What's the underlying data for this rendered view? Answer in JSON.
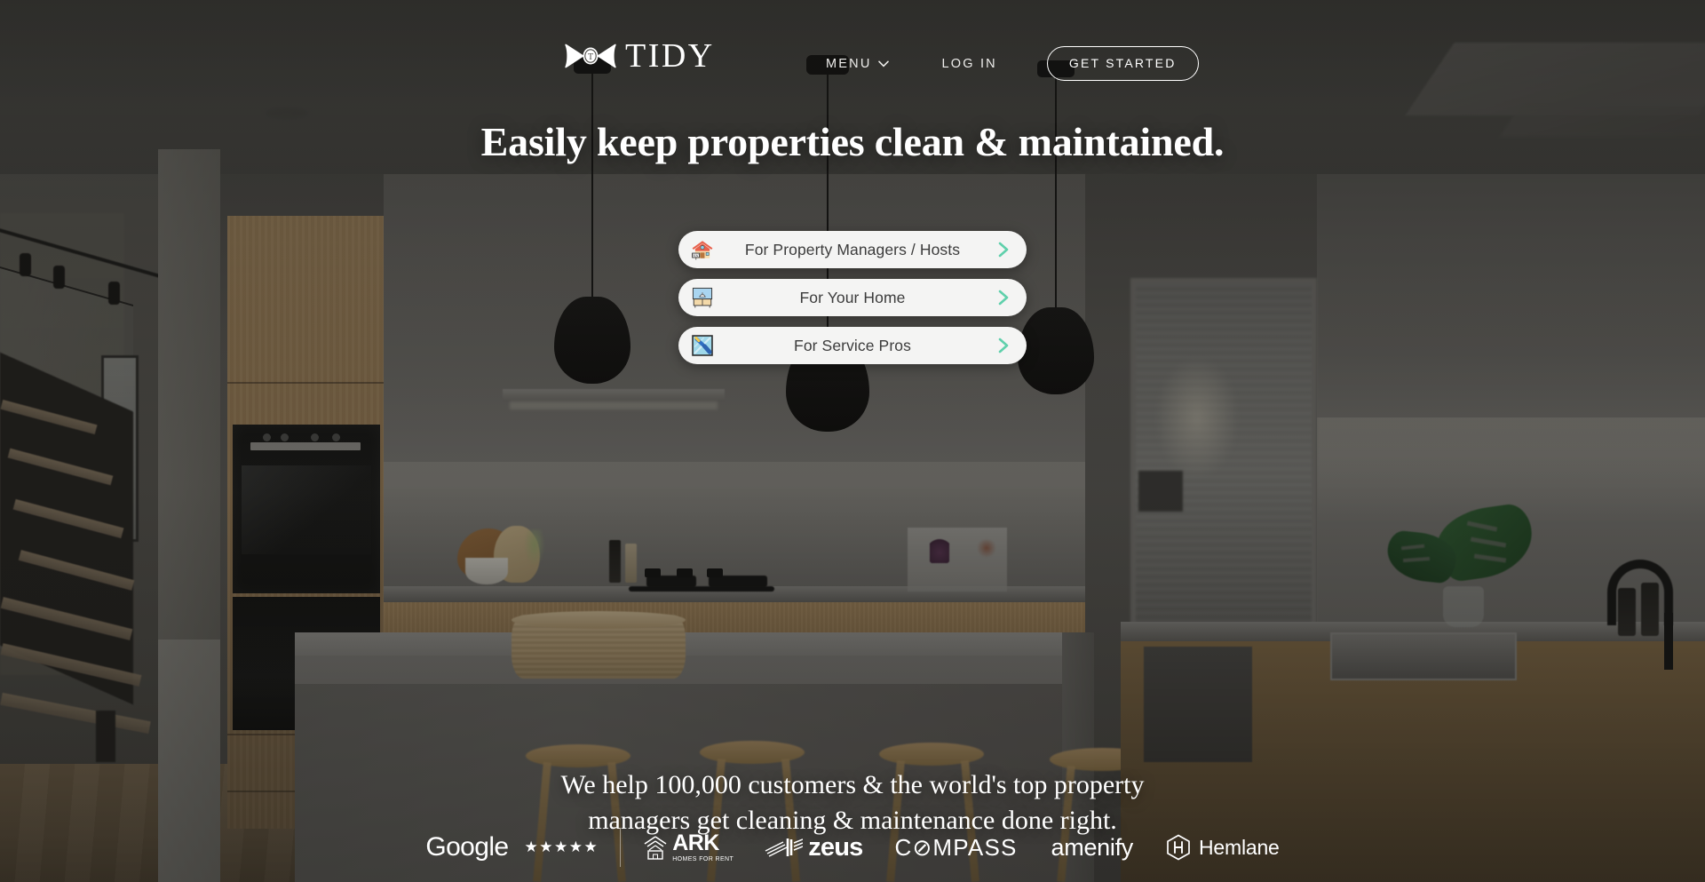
{
  "brand": {
    "name": "TIDY",
    "logo_icon": "bow-ribbon-icon",
    "logo_monogram": "T"
  },
  "header": {
    "menu_label": "MENU",
    "menu_chevron_icon": "chevron-down-icon",
    "login_label": "LOG IN",
    "get_started_label": "GET STARTED"
  },
  "hero": {
    "headline": "Easily keep properties clean & maintained.",
    "ctas": [
      {
        "label": "For Property Managers / Hosts",
        "icon": "house-with-rent-sign-icon",
        "arrow_icon": "chevron-right-icon"
      },
      {
        "label": "For Your Home",
        "icon": "bathroom-sink-vanity-icon",
        "arrow_icon": "chevron-right-icon"
      },
      {
        "label": "For Service Pros",
        "icon": "window-squeegee-icon",
        "arrow_icon": "chevron-right-icon"
      }
    ]
  },
  "social_proof": {
    "line1": "We help 100,000 customers & the world's top property",
    "line2": "managers get cleaning & maintenance done right.",
    "logos": [
      {
        "name": "Google",
        "text": "Google",
        "rating_stars": "★★★★★",
        "star_count": 5
      },
      {
        "name": "ARK",
        "text": "ARK",
        "tagline": "HOMES FOR RENT",
        "icon": "ark-house-mark-icon"
      },
      {
        "name": "zeus",
        "text": "zeus",
        "icon": "zeus-arrow-mark-icon"
      },
      {
        "name": "Compass",
        "text": "C⊘MPASS"
      },
      {
        "name": "amenify",
        "text": "amenify"
      },
      {
        "name": "Hemlane",
        "text": "Hemlane",
        "icon": "hemlane-hexagon-h-icon"
      }
    ]
  },
  "colors": {
    "accent_mint": "#5fd0ab",
    "cta_background": "#f4f4f3",
    "cta_text": "#3c3c3c",
    "text_on_photo": "#ffffff"
  },
  "background": {
    "scene": "modern-kitchen-interior",
    "elements": [
      "three-black-pendant-lights",
      "wood-cabinetry",
      "black-wall-oven",
      "gas-cooktop",
      "white-kitchen-island",
      "woven-basket",
      "wooden-bar-stools",
      "floating-staircase",
      "track-lighting",
      "frosted-glass-partition",
      "monstera-plant",
      "black-faucet",
      "skylight"
    ]
  }
}
